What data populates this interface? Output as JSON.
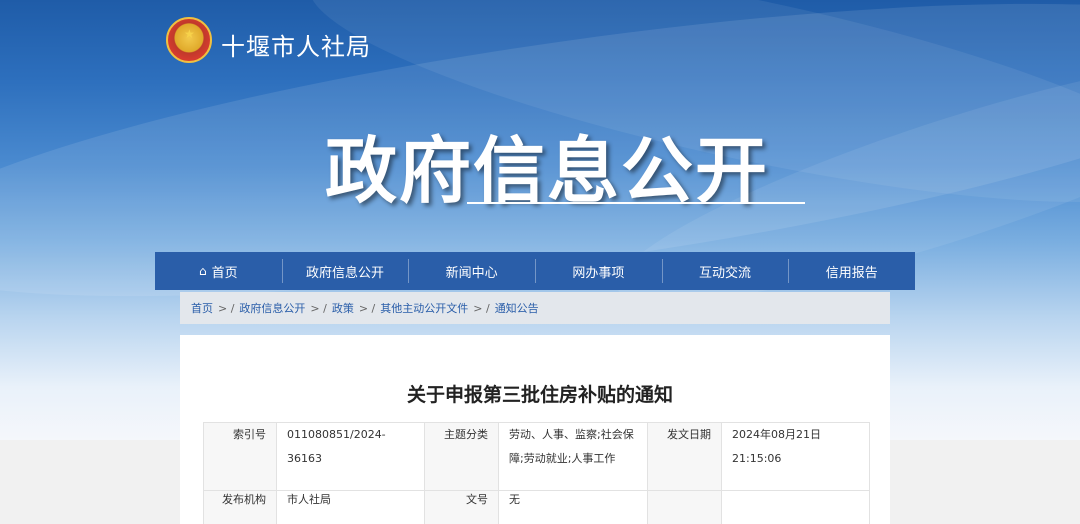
{
  "header": {
    "site_name": "十堰市人社局",
    "banner_title": "政府信息公开",
    "emblem": "national-emblem"
  },
  "nav": {
    "items": [
      {
        "label": "首页",
        "icon": "home-icon"
      },
      {
        "label": "政府信息公开"
      },
      {
        "label": "新闻中心"
      },
      {
        "label": "网办事项"
      },
      {
        "label": "互动交流"
      },
      {
        "label": "信用报告"
      }
    ]
  },
  "breadcrumb": {
    "items": [
      "首页",
      "政府信息公开",
      "政策",
      "其他主动公开文件",
      "通知公告"
    ],
    "separator": ">  /"
  },
  "document": {
    "title": "关于申报第三批住房补贴的通知",
    "meta": {
      "index_label": "索引号",
      "index_value": "011080851/2024-36163",
      "topic_label": "主题分类",
      "topic_value": "劳动、人事、监察;社会保障;劳动就业;人事工作",
      "date_label": "发文日期",
      "date_value": "2024年08月21日 21:15:06",
      "publisher_label": "发布机构",
      "publisher_value": "市人社局",
      "docno_label": "文号",
      "docno_value": "无"
    }
  },
  "colors": {
    "nav_bg": "#2a5ea9",
    "link": "#2a5ea9",
    "crumb_bg": "#e3e7ec"
  }
}
